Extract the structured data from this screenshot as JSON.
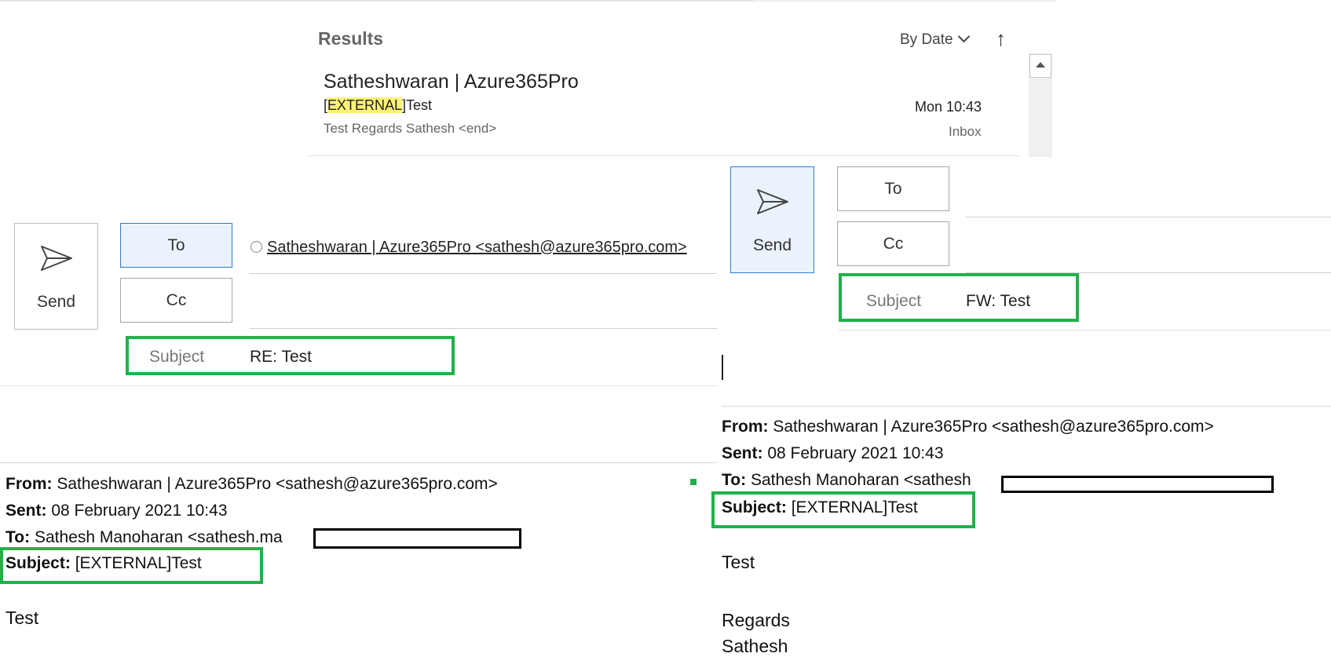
{
  "search_results": {
    "title": "Results",
    "sort_label": "By Date",
    "sort_direction_icon": "arrow-up-icon",
    "message": {
      "sender": "Satheshwaran | Azure365Pro",
      "subject_prefix": "[",
      "subject_highlight": "EXTERNAL",
      "subject_suffix": "]Test",
      "date": "Mon 10:43",
      "preview": "Test  Regards  Sathesh <end>",
      "folder": "Inbox"
    }
  },
  "reply": {
    "send_label": "Send",
    "to_button": "To",
    "cc_button": "Cc",
    "recipient": "Satheshwaran | Azure365Pro <sathesh@azure365pro.com>",
    "subject_label": "Subject",
    "subject_value": "RE: Test",
    "quoted": {
      "from_label": "From:",
      "from_value": "Satheshwaran | Azure365Pro <sathesh@azure365pro.com>",
      "sent_label": "Sent:",
      "sent_value": "08 February 2021 10:43",
      "to_label": "To:",
      "to_value": "Sathesh Manoharan <sathesh.ma",
      "subject_label": "Subject:",
      "subject_value": "[EXTERNAL]Test"
    },
    "body_line1": "Test"
  },
  "forward": {
    "send_label": "Send",
    "to_button": "To",
    "cc_button": "Cc",
    "subject_label": "Subject",
    "subject_value": "FW: Test",
    "quoted": {
      "from_label": "From:",
      "from_value": "Satheshwaran | Azure365Pro <sathesh@azure365pro.com>",
      "sent_label": "Sent:",
      "sent_value": "08 February 2021 10:43",
      "to_label": "To:",
      "to_value": "Sathesh Manoharan <sathesh",
      "subject_label": "Subject:",
      "subject_value": "[EXTERNAL]Test"
    },
    "body_line1": "Test",
    "body_line2": "Regards",
    "body_line3": "Sathesh"
  },
  "colors": {
    "highlight_box": "#21b14a",
    "search_highlight": "#fdf276",
    "selected_button": "#eaf3fc"
  }
}
